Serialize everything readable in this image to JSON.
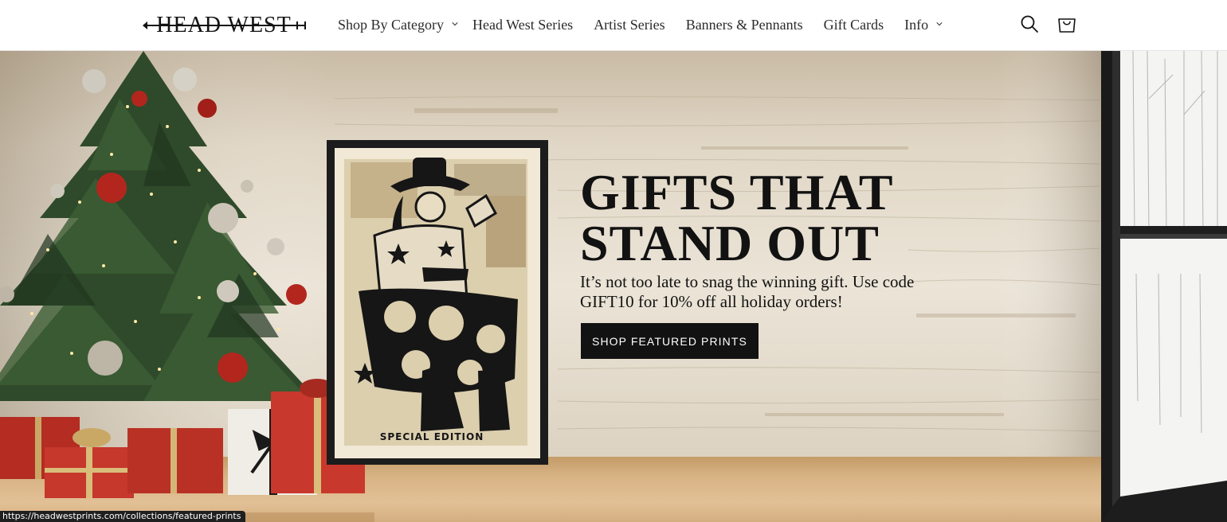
{
  "header": {
    "logo_text": "HEAD WEST",
    "nav": [
      {
        "label": "Shop By Category",
        "dropdown": true
      },
      {
        "label": "Head West Series",
        "dropdown": false
      },
      {
        "label": "Artist Series",
        "dropdown": false
      },
      {
        "label": "Banners & Pennants",
        "dropdown": false
      },
      {
        "label": "Gift Cards",
        "dropdown": false
      },
      {
        "label": "Info",
        "dropdown": true
      }
    ],
    "icons": [
      "search-icon",
      "cart-icon"
    ]
  },
  "hero": {
    "title": "GIFTS THAT\nSTAND OUT",
    "text": "It’s not too late to snag the winning gift. Use code GIFT10 for 10% off all holiday orders!",
    "button_label": "SHOP FEATURED PRINTS",
    "poster_label": "SPECIAL EDITION"
  },
  "status_bar": {
    "url": "https://headwestprints.com/collections/featured-prints"
  },
  "colors": {
    "text": "#121212",
    "button_bg": "#121212",
    "button_text": "#ffffff",
    "ornament_red": "#b3261e",
    "gift_red": "#c6372c"
  }
}
